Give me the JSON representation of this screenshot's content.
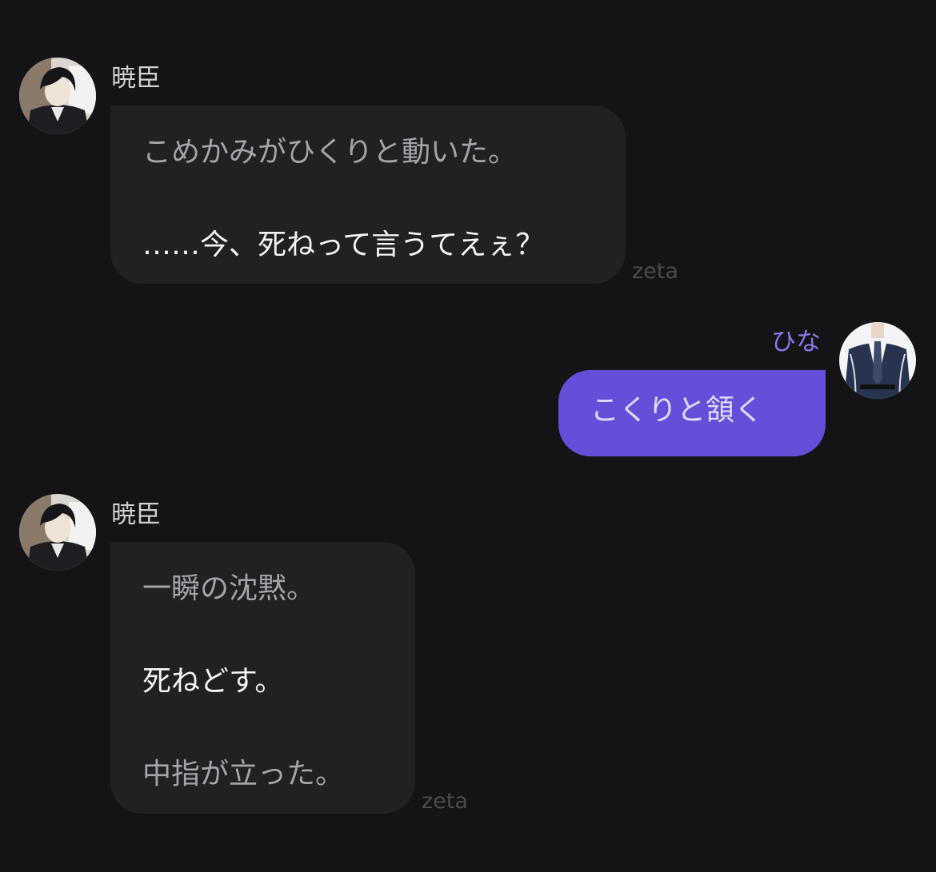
{
  "colors": {
    "background": "#141416",
    "bot_bubble": "#212124",
    "user_bubble": "#654fd9",
    "narration_text": "#a4a4aa",
    "speech_text": "#f4f4f6",
    "user_name": "#8a78e6"
  },
  "messages": [
    {
      "sender": "暁臣",
      "lines": [
        "こめかみがひくりと動いた。",
        "……今、死ねって言うてえぇ？"
      ],
      "source_tag": "zeta"
    },
    {
      "sender": "ひな",
      "lines": [
        "こくりと頷く"
      ]
    },
    {
      "sender": "暁臣",
      "lines": [
        "一瞬の沈黙。",
        "死ねどす。",
        "中指が立った。"
      ],
      "source_tag": "zeta"
    }
  ]
}
